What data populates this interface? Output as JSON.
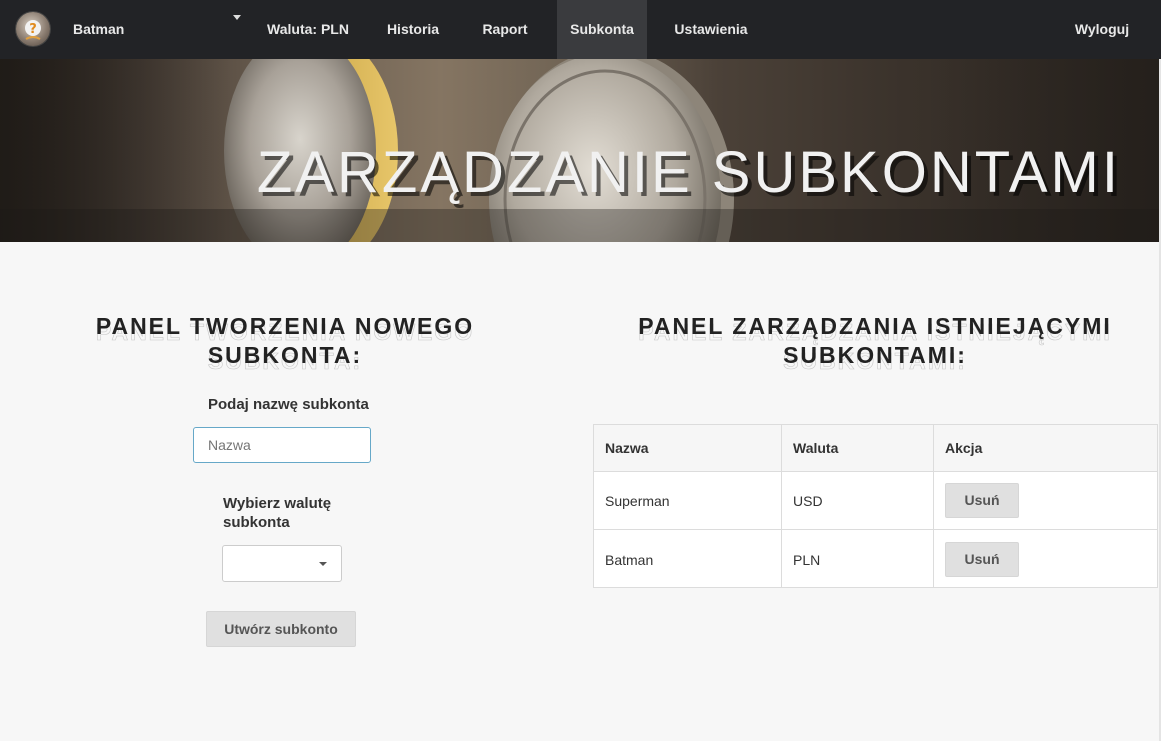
{
  "navbar": {
    "user_name": "Batman",
    "items": [
      {
        "label": "Waluta: PLN"
      },
      {
        "label": "Historia"
      },
      {
        "label": "Raport"
      },
      {
        "label": "Subkonta"
      },
      {
        "label": "Ustawienia"
      }
    ],
    "active": "Subkonta",
    "logout": "Wyloguj"
  },
  "hero": {
    "title": "ZARZĄDZANIE SUBKONTAMI"
  },
  "create_panel": {
    "title": "PANEL TWORZENIA NOWEGO SUBKONTA:",
    "name_label": "Podaj nazwę subkonta",
    "name_placeholder": "Nazwa",
    "name_value": "",
    "currency_label_line1": "Wybierz walutę",
    "currency_label_line2": "subkonta",
    "currency_selected": "",
    "submit_label": "Utwórz subkonto"
  },
  "manage_panel": {
    "title_line1": "PANEL ZARZĄDZANIA ISTNIEJĄCYMI",
    "title_line2": "SUBKONTAMI:",
    "columns": [
      "Nazwa",
      "Waluta",
      "Akcja"
    ],
    "rows": [
      {
        "name": "Superman",
        "currency": "USD",
        "action": "Usuń"
      },
      {
        "name": "Batman",
        "currency": "PLN",
        "action": "Usuń"
      }
    ]
  },
  "colors": {
    "navbar_bg": "#222326",
    "active_tab_bg": "#3a3b3e",
    "page_bg": "#f7f7f7",
    "input_focus_border": "#66a8c8"
  },
  "icons": {
    "avatar": "question-mark-avatar",
    "dropdown": "caret-down-icon"
  }
}
